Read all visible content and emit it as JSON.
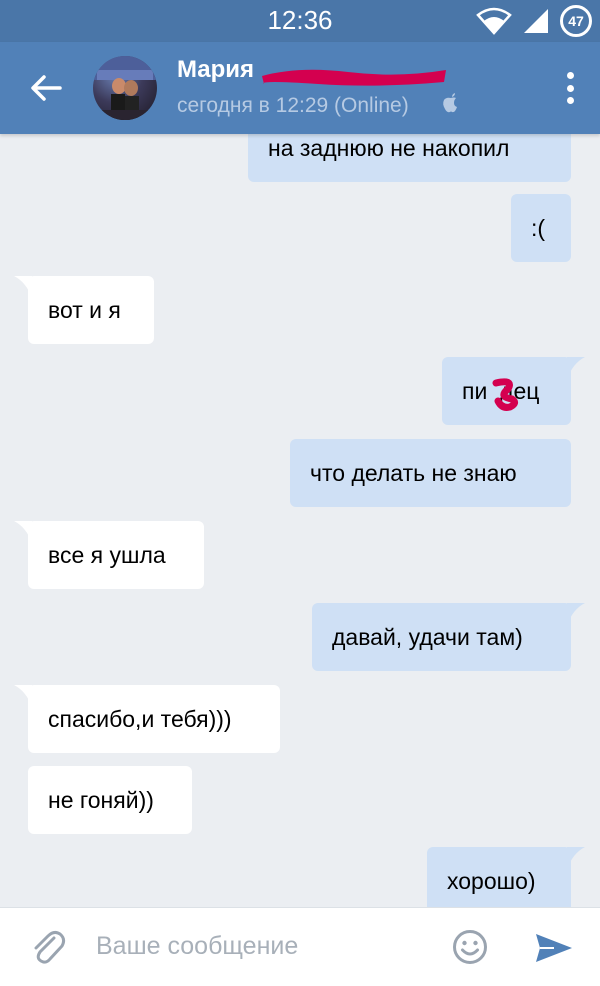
{
  "status_bar": {
    "time": "12:36",
    "battery": "47"
  },
  "header": {
    "contact_name": "Мария",
    "status": "сегодня в 12:29 (Online)"
  },
  "messages": [
    {
      "text": "на заднюю не накопил",
      "direction": "out"
    },
    {
      "text": ":(",
      "direction": "out"
    },
    {
      "text": "вот и я",
      "direction": "in"
    },
    {
      "text": "пи  дец",
      "direction": "out"
    },
    {
      "text": "что делать не знаю",
      "direction": "out"
    },
    {
      "text": "все я ушла",
      "direction": "in"
    },
    {
      "text": "давай, удачи там)",
      "direction": "out"
    },
    {
      "text": "спасибо,и тебя)))",
      "direction": "in"
    },
    {
      "text": "не гоняй))",
      "direction": "in"
    },
    {
      "text": "хорошо)",
      "direction": "out"
    }
  ],
  "composer": {
    "placeholder": "Ваше сообщение"
  },
  "icons": {
    "back": "arrow-left-icon",
    "more": "more-vertical-icon",
    "apple": "apple-icon",
    "attach": "paperclip-icon",
    "emoji": "smile-icon",
    "send": "send-icon"
  },
  "colors": {
    "header": "#5181b8",
    "status_bar": "#4a76a8",
    "background": "#ebeef2",
    "outgoing_bubble": "#cfe0f5",
    "incoming_bubble": "#ffffff",
    "accent": "#5181b8",
    "redaction": "#d4004f"
  }
}
